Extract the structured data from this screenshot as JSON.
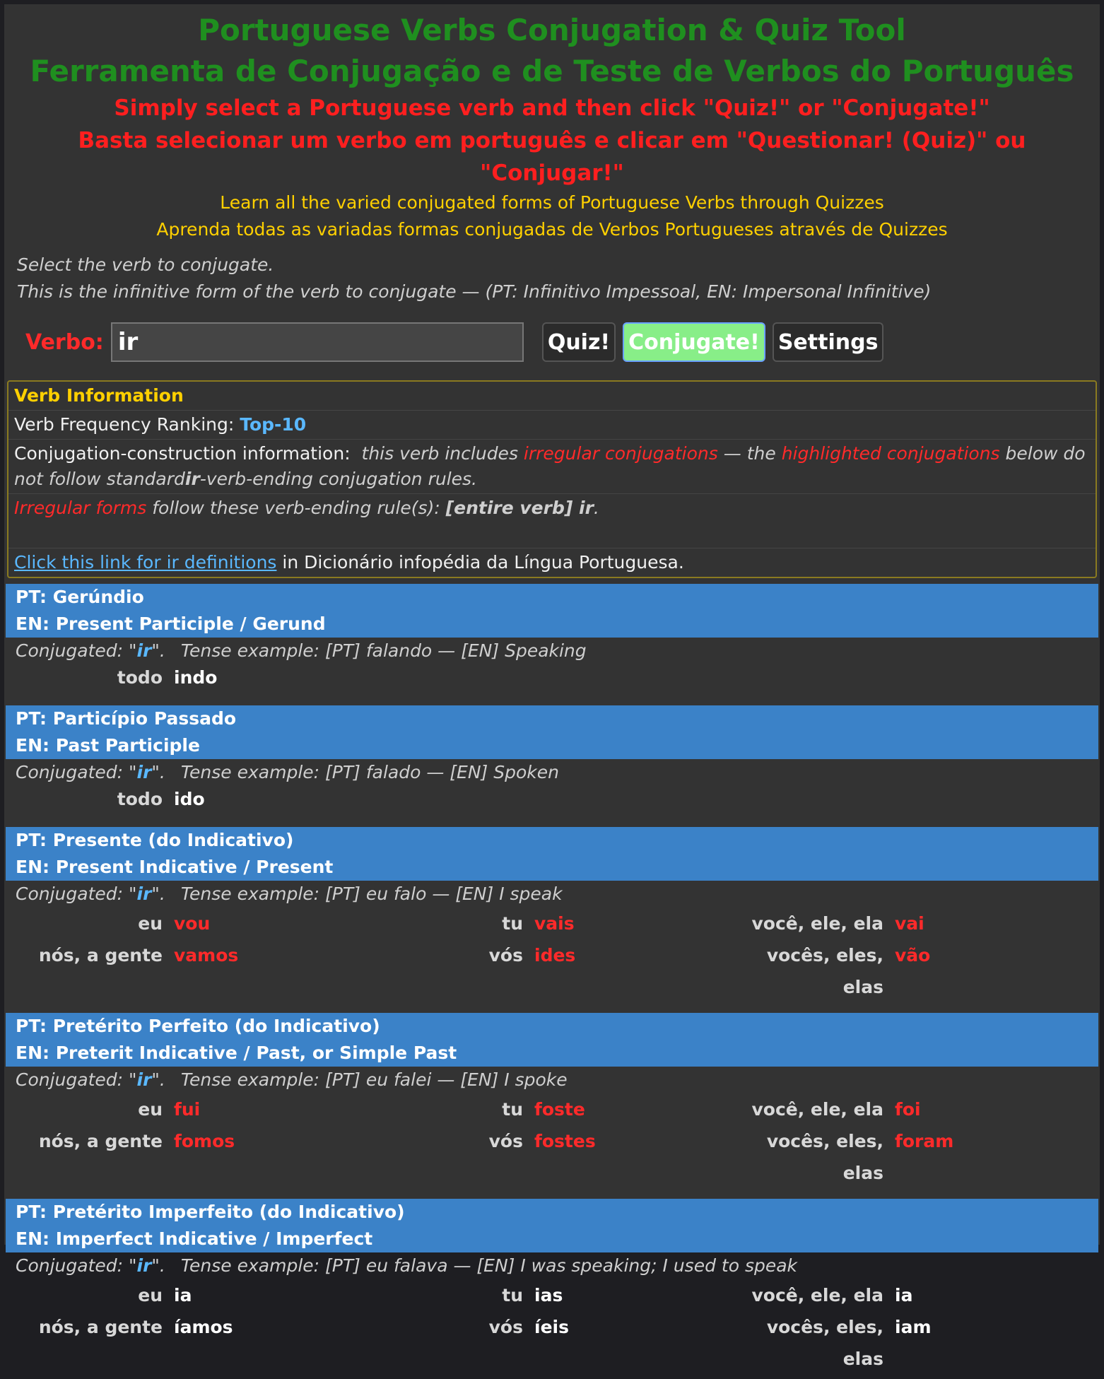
{
  "header": {
    "title_en": "Portuguese Verbs Conjugation & Quiz Tool",
    "title_pt": "Ferramenta de Conjugação e de Teste de Verbos do Português",
    "instruction_en": "Simply select a Portuguese verb and then click \"Quiz!\" or \"Conjugate!\"",
    "instruction_pt": "Basta selecionar um verbo em português e clicar em \"Questionar! (Quiz)\" ou \"Conjugar!\"",
    "subtitle_en": "Learn all the varied conjugated forms of Portuguese Verbs through Quizzes",
    "subtitle_pt": "Aprenda todas as variadas formas conjugadas de Verbos Portugueses através de Quizzes"
  },
  "intro": {
    "line1": "Select the verb to conjugate.",
    "line2": "This is the infinitive form of the verb to conjugate — (PT: Infinitivo Impessoal, EN: Impersonal Infinitive)"
  },
  "verb_form": {
    "label": "Verbo:",
    "value": "ir",
    "quiz_button": "Quiz!",
    "conjugate_button": "Conjugate!",
    "settings_button": "Settings"
  },
  "verb_info": {
    "heading": "Verb Information",
    "freq_label": "Verb Frequency Ranking:",
    "freq_value": "Top-10",
    "construction_label": "Conjugation-construction information:",
    "construction_a": "this verb includes",
    "construction_b": "irregular conjugations",
    "construction_c": "— the",
    "construction_d": "highlighted conjugations",
    "construction_e": "below do not follow standard",
    "construction_f": "ir",
    "construction_g": "-verb-ending conjugation rules.",
    "irregular_a": "Irregular forms",
    "irregular_b": "follow these verb-ending rule(s):",
    "irregular_c": "[entire verb] ir",
    "irregular_d": ".",
    "link_text": "Click this link for ir definitions",
    "link_suffix": "in Dicionário infopédia da Língua Portuguesa."
  },
  "conjugated_prefix": "Conjugated: \"",
  "conjugated_verb": "ir",
  "conjugated_suffix": "\".",
  "tenses": [
    {
      "pt": "PT: Gerúndio",
      "en": "EN: Present Participle / Gerund",
      "example": "Tense example: [PT] falando — [EN] Speaking",
      "pronoun": "todo",
      "form": "indo"
    },
    {
      "pt": "PT: Particípio Passado",
      "en": "EN: Past Participle",
      "example": "Tense example: [PT] falado — [EN] Spoken",
      "pronoun": "todo",
      "form": "ido"
    },
    {
      "pt": "PT: Presente (do Indicativo)",
      "en": "EN: Present Indicative / Present",
      "example": "Tense example: [PT] eu falo — [EN] I speak",
      "rows": [
        [
          {
            "p": "eu",
            "f": "vou",
            "irr": true
          },
          {
            "p": "tu",
            "f": "vais",
            "irr": true
          },
          {
            "p": "você, ele, ela",
            "f": "vai",
            "irr": true
          }
        ],
        [
          {
            "p": "nós, a gente",
            "f": "vamos",
            "irr": true
          },
          {
            "p": "vós",
            "f": "ides",
            "irr": true
          },
          {
            "p": "vocês, eles, elas",
            "f": "vão",
            "irr": true
          }
        ]
      ]
    },
    {
      "pt": "PT: Pretérito Perfeito (do Indicativo)",
      "en": "EN: Preterit Indicative / Past, or Simple Past",
      "example": "Tense example: [PT] eu falei — [EN] I spoke",
      "rows": [
        [
          {
            "p": "eu",
            "f": "fui",
            "irr": true
          },
          {
            "p": "tu",
            "f": "foste",
            "irr": true
          },
          {
            "p": "você, ele, ela",
            "f": "foi",
            "irr": true
          }
        ],
        [
          {
            "p": "nós, a gente",
            "f": "fomos",
            "irr": true
          },
          {
            "p": "vós",
            "f": "fostes",
            "irr": true
          },
          {
            "p": "vocês, eles, elas",
            "f": "foram",
            "irr": true
          }
        ]
      ]
    },
    {
      "pt": "PT: Pretérito Imperfeito (do Indicativo)",
      "en": "EN: Imperfect Indicative / Imperfect",
      "example": "Tense example: [PT] eu falava — [EN] I was speaking; I used to speak",
      "rows": [
        [
          {
            "p": "eu",
            "f": "ia",
            "irr": false
          },
          {
            "p": "tu",
            "f": "ias",
            "irr": false
          },
          {
            "p": "você, ele, ela",
            "f": "ia",
            "irr": false
          }
        ],
        [
          {
            "p": "nós, a gente",
            "f": "íamos",
            "irr": false
          },
          {
            "p": "vós",
            "f": "íeis",
            "irr": false
          },
          {
            "p": "vocês, eles, elas",
            "f": "iam",
            "irr": false
          }
        ]
      ]
    }
  ],
  "colors": {
    "title_green": "#1f8f1f",
    "instruction_red": "#ff1f1f",
    "subtitle_yellow": "#ffd000",
    "tense_bar_blue": "#3b82c8",
    "irregular_red": "#ff2a2a"
  }
}
